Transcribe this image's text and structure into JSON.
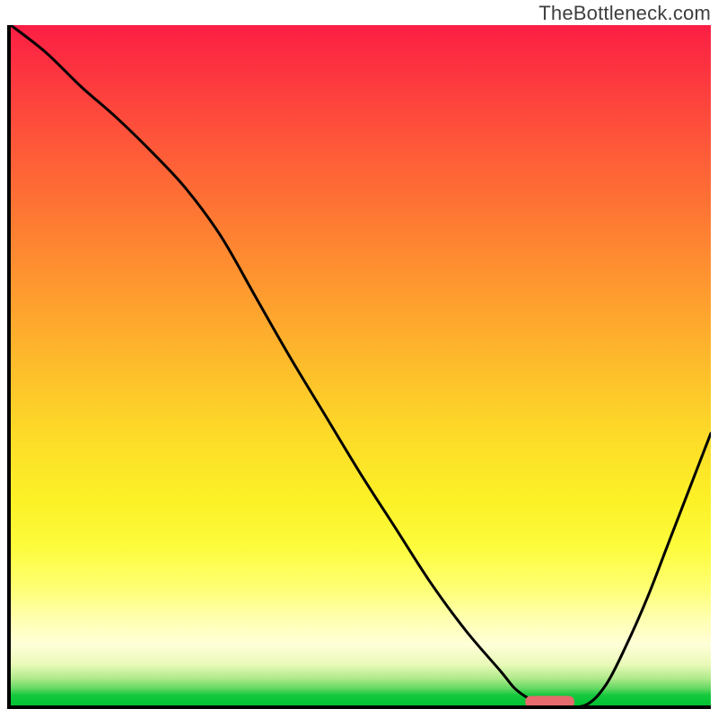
{
  "watermark": "TheBottleneck.com",
  "chart_data": {
    "type": "line",
    "title": "",
    "xlabel": "",
    "ylabel": "",
    "xlim": [
      0,
      100
    ],
    "ylim": [
      0,
      100
    ],
    "grid": false,
    "legend": false,
    "series": [
      {
        "name": "bottleneck-curve",
        "x": [
          0,
          5,
          10,
          15,
          20,
          25,
          30,
          35,
          40,
          45,
          50,
          55,
          60,
          65,
          70,
          72,
          74,
          76,
          78,
          82,
          85,
          88,
          91,
          94,
          97,
          100
        ],
        "values": [
          100,
          96,
          91,
          86.5,
          81.5,
          76,
          69,
          60,
          51,
          42.5,
          34,
          26,
          18,
          11,
          5,
          2.5,
          1,
          0,
          0,
          0,
          3,
          9,
          16,
          24,
          32,
          40
        ],
        "color": "#000000",
        "stroke_width": 3
      }
    ],
    "background_gradient": {
      "orientation": "vertical",
      "stops": [
        {
          "pos": 0.0,
          "color": "#fc1e44"
        },
        {
          "pos": 0.1,
          "color": "#fd3f3e"
        },
        {
          "pos": 0.18,
          "color": "#fe5939"
        },
        {
          "pos": 0.28,
          "color": "#fe7833"
        },
        {
          "pos": 0.4,
          "color": "#fe9d2f"
        },
        {
          "pos": 0.5,
          "color": "#fdbc2b"
        },
        {
          "pos": 0.6,
          "color": "#fdda28"
        },
        {
          "pos": 0.7,
          "color": "#fcf127"
        },
        {
          "pos": 0.77,
          "color": "#fdfc3e"
        },
        {
          "pos": 0.83,
          "color": "#feff77"
        },
        {
          "pos": 0.87,
          "color": "#ffffad"
        },
        {
          "pos": 0.91,
          "color": "#ffffd8"
        },
        {
          "pos": 0.94,
          "color": "#e9f9b8"
        },
        {
          "pos": 0.96,
          "color": "#b0ea8b"
        },
        {
          "pos": 0.975,
          "color": "#64d862"
        },
        {
          "pos": 0.985,
          "color": "#15c83e"
        },
        {
          "pos": 1.0,
          "color": "#00c233"
        }
      ]
    },
    "marker": {
      "name": "optimum-marker",
      "x_center": 77,
      "y": 0.5,
      "width_x": 7,
      "height_y": 1.8,
      "color": "#e76a6c"
    }
  }
}
